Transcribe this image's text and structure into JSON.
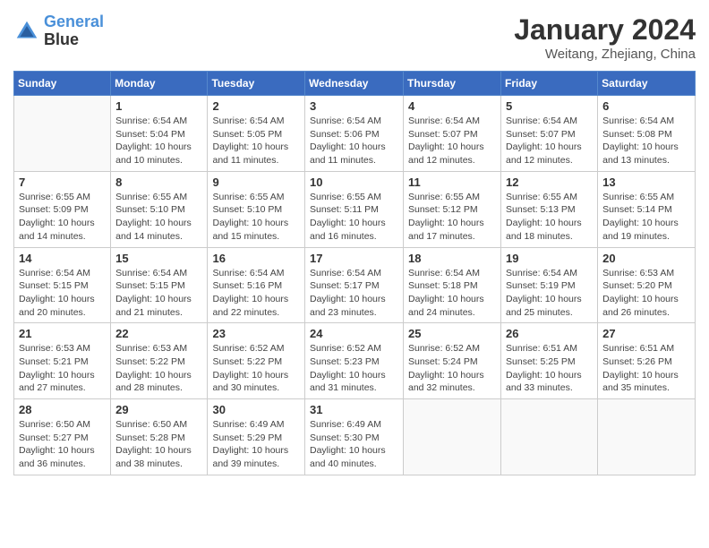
{
  "header": {
    "logo_line1": "General",
    "logo_line2": "Blue",
    "month_title": "January 2024",
    "location": "Weitang, Zhejiang, China"
  },
  "weekdays": [
    "Sunday",
    "Monday",
    "Tuesday",
    "Wednesday",
    "Thursday",
    "Friday",
    "Saturday"
  ],
  "weeks": [
    [
      {
        "day": "",
        "info": ""
      },
      {
        "day": "1",
        "info": "Sunrise: 6:54 AM\nSunset: 5:04 PM\nDaylight: 10 hours\nand 10 minutes."
      },
      {
        "day": "2",
        "info": "Sunrise: 6:54 AM\nSunset: 5:05 PM\nDaylight: 10 hours\nand 11 minutes."
      },
      {
        "day": "3",
        "info": "Sunrise: 6:54 AM\nSunset: 5:06 PM\nDaylight: 10 hours\nand 11 minutes."
      },
      {
        "day": "4",
        "info": "Sunrise: 6:54 AM\nSunset: 5:07 PM\nDaylight: 10 hours\nand 12 minutes."
      },
      {
        "day": "5",
        "info": "Sunrise: 6:54 AM\nSunset: 5:07 PM\nDaylight: 10 hours\nand 12 minutes."
      },
      {
        "day": "6",
        "info": "Sunrise: 6:54 AM\nSunset: 5:08 PM\nDaylight: 10 hours\nand 13 minutes."
      }
    ],
    [
      {
        "day": "7",
        "info": "Sunrise: 6:55 AM\nSunset: 5:09 PM\nDaylight: 10 hours\nand 14 minutes."
      },
      {
        "day": "8",
        "info": "Sunrise: 6:55 AM\nSunset: 5:10 PM\nDaylight: 10 hours\nand 14 minutes."
      },
      {
        "day": "9",
        "info": "Sunrise: 6:55 AM\nSunset: 5:10 PM\nDaylight: 10 hours\nand 15 minutes."
      },
      {
        "day": "10",
        "info": "Sunrise: 6:55 AM\nSunset: 5:11 PM\nDaylight: 10 hours\nand 16 minutes."
      },
      {
        "day": "11",
        "info": "Sunrise: 6:55 AM\nSunset: 5:12 PM\nDaylight: 10 hours\nand 17 minutes."
      },
      {
        "day": "12",
        "info": "Sunrise: 6:55 AM\nSunset: 5:13 PM\nDaylight: 10 hours\nand 18 minutes."
      },
      {
        "day": "13",
        "info": "Sunrise: 6:55 AM\nSunset: 5:14 PM\nDaylight: 10 hours\nand 19 minutes."
      }
    ],
    [
      {
        "day": "14",
        "info": "Sunrise: 6:54 AM\nSunset: 5:15 PM\nDaylight: 10 hours\nand 20 minutes."
      },
      {
        "day": "15",
        "info": "Sunrise: 6:54 AM\nSunset: 5:15 PM\nDaylight: 10 hours\nand 21 minutes."
      },
      {
        "day": "16",
        "info": "Sunrise: 6:54 AM\nSunset: 5:16 PM\nDaylight: 10 hours\nand 22 minutes."
      },
      {
        "day": "17",
        "info": "Sunrise: 6:54 AM\nSunset: 5:17 PM\nDaylight: 10 hours\nand 23 minutes."
      },
      {
        "day": "18",
        "info": "Sunrise: 6:54 AM\nSunset: 5:18 PM\nDaylight: 10 hours\nand 24 minutes."
      },
      {
        "day": "19",
        "info": "Sunrise: 6:54 AM\nSunset: 5:19 PM\nDaylight: 10 hours\nand 25 minutes."
      },
      {
        "day": "20",
        "info": "Sunrise: 6:53 AM\nSunset: 5:20 PM\nDaylight: 10 hours\nand 26 minutes."
      }
    ],
    [
      {
        "day": "21",
        "info": "Sunrise: 6:53 AM\nSunset: 5:21 PM\nDaylight: 10 hours\nand 27 minutes."
      },
      {
        "day": "22",
        "info": "Sunrise: 6:53 AM\nSunset: 5:22 PM\nDaylight: 10 hours\nand 28 minutes."
      },
      {
        "day": "23",
        "info": "Sunrise: 6:52 AM\nSunset: 5:22 PM\nDaylight: 10 hours\nand 30 minutes."
      },
      {
        "day": "24",
        "info": "Sunrise: 6:52 AM\nSunset: 5:23 PM\nDaylight: 10 hours\nand 31 minutes."
      },
      {
        "day": "25",
        "info": "Sunrise: 6:52 AM\nSunset: 5:24 PM\nDaylight: 10 hours\nand 32 minutes."
      },
      {
        "day": "26",
        "info": "Sunrise: 6:51 AM\nSunset: 5:25 PM\nDaylight: 10 hours\nand 33 minutes."
      },
      {
        "day": "27",
        "info": "Sunrise: 6:51 AM\nSunset: 5:26 PM\nDaylight: 10 hours\nand 35 minutes."
      }
    ],
    [
      {
        "day": "28",
        "info": "Sunrise: 6:50 AM\nSunset: 5:27 PM\nDaylight: 10 hours\nand 36 minutes."
      },
      {
        "day": "29",
        "info": "Sunrise: 6:50 AM\nSunset: 5:28 PM\nDaylight: 10 hours\nand 38 minutes."
      },
      {
        "day": "30",
        "info": "Sunrise: 6:49 AM\nSunset: 5:29 PM\nDaylight: 10 hours\nand 39 minutes."
      },
      {
        "day": "31",
        "info": "Sunrise: 6:49 AM\nSunset: 5:30 PM\nDaylight: 10 hours\nand 40 minutes."
      },
      {
        "day": "",
        "info": ""
      },
      {
        "day": "",
        "info": ""
      },
      {
        "day": "",
        "info": ""
      }
    ]
  ]
}
